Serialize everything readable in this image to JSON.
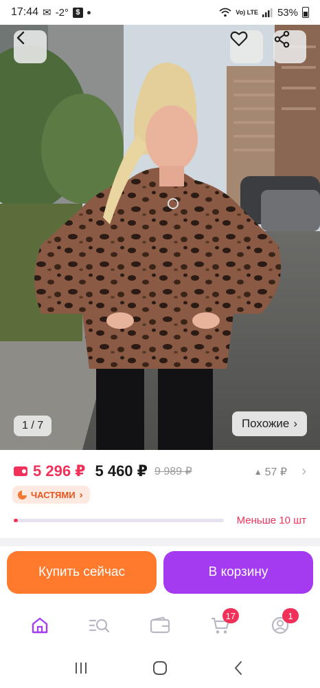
{
  "status_bar": {
    "time": "17:44",
    "temperature": "-2°",
    "network": "Vo) LTE",
    "battery": "53%"
  },
  "gallery": {
    "counter_current": "1",
    "counter_total": "7",
    "similar_label": "Похожие",
    "similar_chevron": "›",
    "back_icon": "chevron-left",
    "favorite_icon": "heart-outline",
    "share_icon": "share"
  },
  "price": {
    "wallet_price": "5 296 ₽",
    "price": "5 460 ₽",
    "old_price": "9 989 ₽",
    "bonus": "57 ₽",
    "bonus_prefix": "▲",
    "bonus_chevron": "›",
    "installments_label": "ЧАСТЯМИ",
    "installments_chevron": "›",
    "stock_text": "Меньше 10 шт",
    "stock_level": 0.02
  },
  "actions": {
    "buy_now": "Купить сейчас",
    "add_to_cart": "В корзину"
  },
  "bottom_nav": {
    "items": [
      {
        "name": "home",
        "icon": "home-icon",
        "active": true
      },
      {
        "name": "catalog",
        "icon": "search-list-icon"
      },
      {
        "name": "wallet",
        "icon": "wallet-icon"
      },
      {
        "name": "cart",
        "icon": "cart-icon",
        "badge": "17"
      },
      {
        "name": "profile",
        "icon": "profile-icon",
        "badge": "1"
      }
    ]
  },
  "colors": {
    "accent_pink": "#f0325a",
    "buy_orange": "#ff7a2d",
    "cart_purple": "#a53bf0",
    "nav_active": "#a53bf0"
  }
}
